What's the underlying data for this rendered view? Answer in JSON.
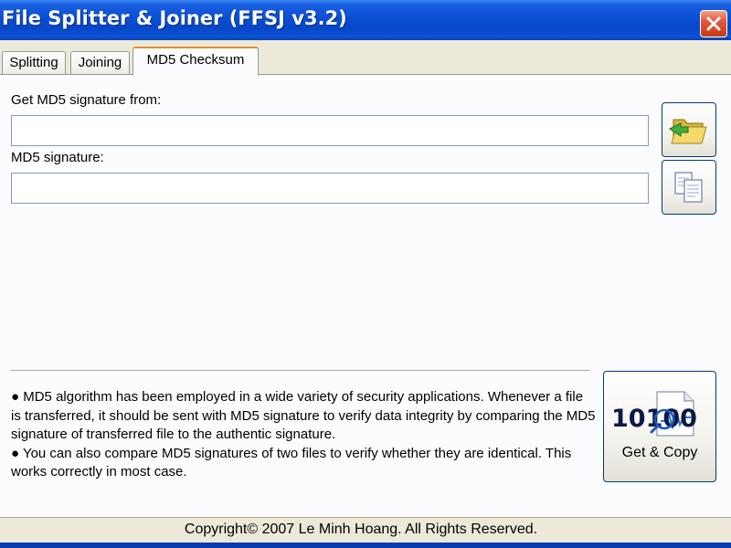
{
  "window": {
    "title": "File Splitter & Joiner (FFSJ v3.2)"
  },
  "tabs": [
    {
      "label": "Splitting"
    },
    {
      "label": "Joining"
    },
    {
      "label": "MD5 Checksum",
      "active": true
    }
  ],
  "md5": {
    "source_label": "Get MD5 signature from:",
    "source_value": "",
    "signature_label": "MD5 signature:",
    "signature_value": ""
  },
  "info": {
    "paragraph1": "● MD5 algorithm has been employed in a wide variety of security applications. Whenever a file is transferred, it should be sent with MD5 signature to verify data integrity by comparing the MD5 signature of transferred file to the authentic signature.",
    "paragraph2": "● You can also compare MD5 signatures of two files to verify whether they are identical. This works correctly in most case."
  },
  "action_button": {
    "label": "Get & Copy",
    "icon_text": "10100"
  },
  "status": {
    "copyright": "Copyright© 2007 Le Minh Hoang. All Rights Reserved."
  },
  "colors": {
    "titlebar": "#0a4fd6",
    "active_tab_accent": "#e68b2c",
    "close_button": "#d7461f"
  },
  "icons": {
    "close": "close-icon",
    "browse": "open-folder-icon",
    "copy": "copy-icon",
    "get_copy": "binary-checksum-icon"
  }
}
